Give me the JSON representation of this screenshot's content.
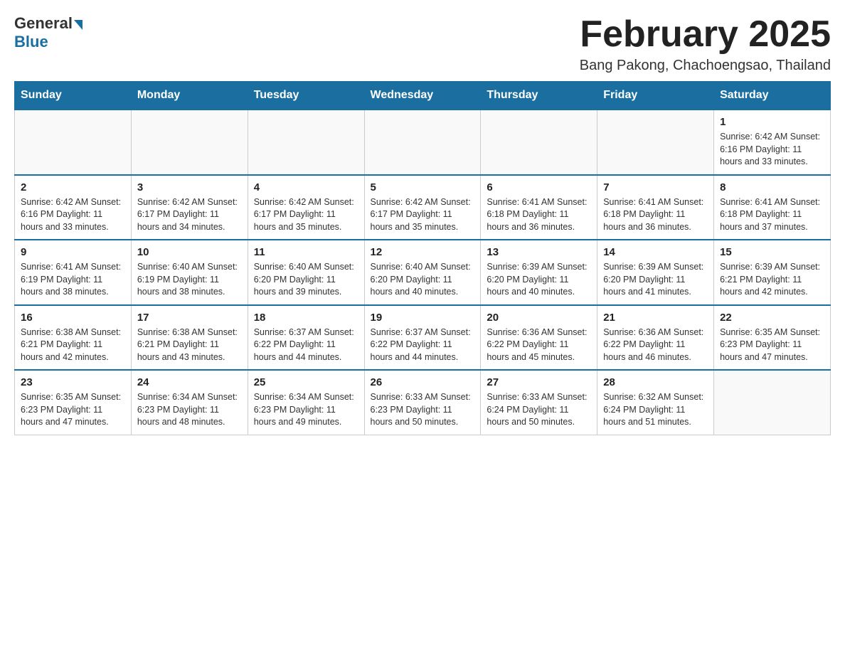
{
  "header": {
    "logo_general": "General",
    "logo_blue": "Blue",
    "title": "February 2025",
    "subtitle": "Bang Pakong, Chachoengsao, Thailand"
  },
  "weekdays": [
    "Sunday",
    "Monday",
    "Tuesday",
    "Wednesday",
    "Thursday",
    "Friday",
    "Saturday"
  ],
  "weeks": [
    [
      {
        "day": "",
        "info": ""
      },
      {
        "day": "",
        "info": ""
      },
      {
        "day": "",
        "info": ""
      },
      {
        "day": "",
        "info": ""
      },
      {
        "day": "",
        "info": ""
      },
      {
        "day": "",
        "info": ""
      },
      {
        "day": "1",
        "info": "Sunrise: 6:42 AM\nSunset: 6:16 PM\nDaylight: 11 hours and 33 minutes."
      }
    ],
    [
      {
        "day": "2",
        "info": "Sunrise: 6:42 AM\nSunset: 6:16 PM\nDaylight: 11 hours and 33 minutes."
      },
      {
        "day": "3",
        "info": "Sunrise: 6:42 AM\nSunset: 6:17 PM\nDaylight: 11 hours and 34 minutes."
      },
      {
        "day": "4",
        "info": "Sunrise: 6:42 AM\nSunset: 6:17 PM\nDaylight: 11 hours and 35 minutes."
      },
      {
        "day": "5",
        "info": "Sunrise: 6:42 AM\nSunset: 6:17 PM\nDaylight: 11 hours and 35 minutes."
      },
      {
        "day": "6",
        "info": "Sunrise: 6:41 AM\nSunset: 6:18 PM\nDaylight: 11 hours and 36 minutes."
      },
      {
        "day": "7",
        "info": "Sunrise: 6:41 AM\nSunset: 6:18 PM\nDaylight: 11 hours and 36 minutes."
      },
      {
        "day": "8",
        "info": "Sunrise: 6:41 AM\nSunset: 6:18 PM\nDaylight: 11 hours and 37 minutes."
      }
    ],
    [
      {
        "day": "9",
        "info": "Sunrise: 6:41 AM\nSunset: 6:19 PM\nDaylight: 11 hours and 38 minutes."
      },
      {
        "day": "10",
        "info": "Sunrise: 6:40 AM\nSunset: 6:19 PM\nDaylight: 11 hours and 38 minutes."
      },
      {
        "day": "11",
        "info": "Sunrise: 6:40 AM\nSunset: 6:20 PM\nDaylight: 11 hours and 39 minutes."
      },
      {
        "day": "12",
        "info": "Sunrise: 6:40 AM\nSunset: 6:20 PM\nDaylight: 11 hours and 40 minutes."
      },
      {
        "day": "13",
        "info": "Sunrise: 6:39 AM\nSunset: 6:20 PM\nDaylight: 11 hours and 40 minutes."
      },
      {
        "day": "14",
        "info": "Sunrise: 6:39 AM\nSunset: 6:20 PM\nDaylight: 11 hours and 41 minutes."
      },
      {
        "day": "15",
        "info": "Sunrise: 6:39 AM\nSunset: 6:21 PM\nDaylight: 11 hours and 42 minutes."
      }
    ],
    [
      {
        "day": "16",
        "info": "Sunrise: 6:38 AM\nSunset: 6:21 PM\nDaylight: 11 hours and 42 minutes."
      },
      {
        "day": "17",
        "info": "Sunrise: 6:38 AM\nSunset: 6:21 PM\nDaylight: 11 hours and 43 minutes."
      },
      {
        "day": "18",
        "info": "Sunrise: 6:37 AM\nSunset: 6:22 PM\nDaylight: 11 hours and 44 minutes."
      },
      {
        "day": "19",
        "info": "Sunrise: 6:37 AM\nSunset: 6:22 PM\nDaylight: 11 hours and 44 minutes."
      },
      {
        "day": "20",
        "info": "Sunrise: 6:36 AM\nSunset: 6:22 PM\nDaylight: 11 hours and 45 minutes."
      },
      {
        "day": "21",
        "info": "Sunrise: 6:36 AM\nSunset: 6:22 PM\nDaylight: 11 hours and 46 minutes."
      },
      {
        "day": "22",
        "info": "Sunrise: 6:35 AM\nSunset: 6:23 PM\nDaylight: 11 hours and 47 minutes."
      }
    ],
    [
      {
        "day": "23",
        "info": "Sunrise: 6:35 AM\nSunset: 6:23 PM\nDaylight: 11 hours and 47 minutes."
      },
      {
        "day": "24",
        "info": "Sunrise: 6:34 AM\nSunset: 6:23 PM\nDaylight: 11 hours and 48 minutes."
      },
      {
        "day": "25",
        "info": "Sunrise: 6:34 AM\nSunset: 6:23 PM\nDaylight: 11 hours and 49 minutes."
      },
      {
        "day": "26",
        "info": "Sunrise: 6:33 AM\nSunset: 6:23 PM\nDaylight: 11 hours and 50 minutes."
      },
      {
        "day": "27",
        "info": "Sunrise: 6:33 AM\nSunset: 6:24 PM\nDaylight: 11 hours and 50 minutes."
      },
      {
        "day": "28",
        "info": "Sunrise: 6:32 AM\nSunset: 6:24 PM\nDaylight: 11 hours and 51 minutes."
      },
      {
        "day": "",
        "info": ""
      }
    ]
  ]
}
